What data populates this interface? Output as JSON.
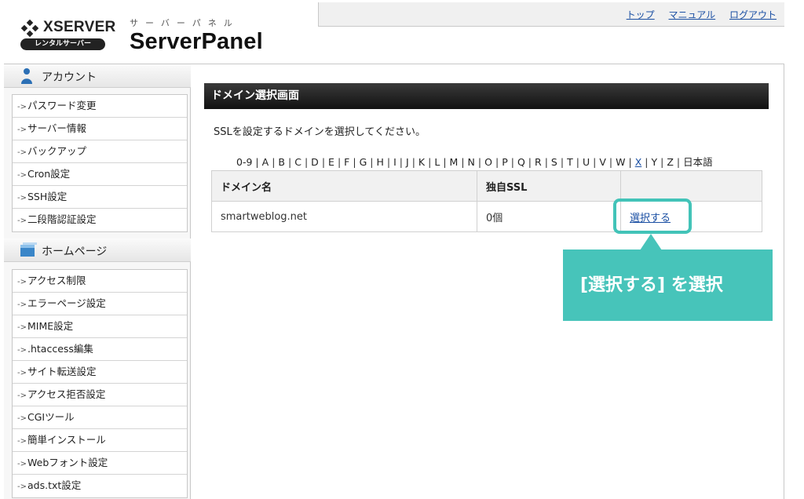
{
  "header": {
    "brand": "XSERVER",
    "brand_sub": "レンタルサーバー",
    "panel_kana": "サーバーパネル",
    "panel_name": "ServerPanel",
    "links": [
      "トップ",
      "マニュアル",
      "ログアウト"
    ]
  },
  "sidebar": {
    "sections": [
      {
        "title": "アカウント",
        "icon": "user-icon",
        "items": [
          "パスワード変更",
          "サーバー情報",
          "バックアップ",
          "Cron設定",
          "SSH設定",
          "二段階認証設定"
        ]
      },
      {
        "title": "ホームページ",
        "icon": "homepage-icon",
        "items": [
          "アクセス制限",
          "エラーページ設定",
          "MIME設定",
          ".htaccess編集",
          "サイト転送設定",
          "アクセス拒否設定",
          "CGIツール",
          "簡単インストール",
          "Webフォント設定",
          "ads.txt設定"
        ]
      }
    ]
  },
  "main": {
    "title": "ドメイン選択画面",
    "description": "SSLを設定するドメインを選択してください。",
    "alpha_index": [
      "0-9",
      "A",
      "B",
      "C",
      "D",
      "E",
      "F",
      "G",
      "H",
      "I",
      "J",
      "K",
      "L",
      "M",
      "N",
      "O",
      "P",
      "Q",
      "R",
      "S",
      "T",
      "U",
      "V",
      "W",
      "X",
      "Y",
      "Z",
      "日本語"
    ],
    "alpha_link": "X",
    "table": {
      "headers": [
        "ドメイン名",
        "独自SSL",
        ""
      ],
      "rows": [
        {
          "domain": "smartweblog.net",
          "ssl": "0個",
          "action": "選択する"
        }
      ]
    }
  },
  "callout": {
    "text": "[選択する] を選択",
    "color": "#47c4ba"
  }
}
